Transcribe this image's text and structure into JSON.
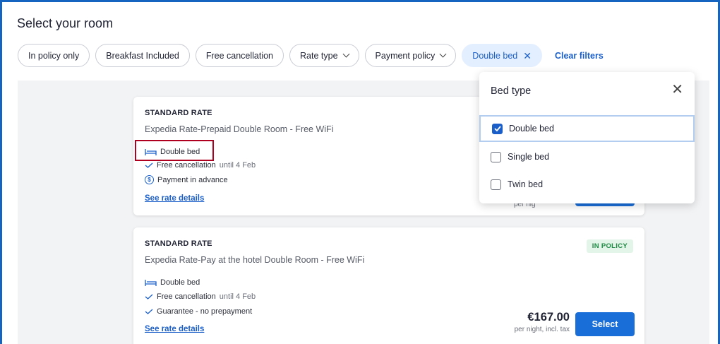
{
  "page": {
    "title": "Select your room"
  },
  "filters": {
    "chips": [
      {
        "label": "In policy only"
      },
      {
        "label": "Breakfast Included"
      },
      {
        "label": "Free cancellation"
      },
      {
        "label": "Rate type"
      },
      {
        "label": "Payment policy"
      },
      {
        "label": "Double bed"
      }
    ],
    "clear_label": "Clear filters"
  },
  "rates": [
    {
      "title": "STANDARD RATE",
      "description": "Expedia Rate-Prepaid Double Room - Free WiFi",
      "bed": "Double bed",
      "cancellation": "Free cancellation",
      "cancellation_until": "until 4 Feb",
      "payment": "Payment in advance",
      "details_link": "See rate details",
      "price_sub_peek": "per nig"
    },
    {
      "title": "STANDARD RATE",
      "description": "Expedia Rate-Pay at the hotel Double Room - Free WiFi",
      "badge": "IN POLICY",
      "bed": "Double bed",
      "cancellation": "Free cancellation",
      "cancellation_until": "until 4 Feb",
      "payment": "Guarantee - no prepayment",
      "details_link": "See rate details",
      "price": "€167.00",
      "price_sub": "per night, incl. tax",
      "select_label": "Select"
    }
  ],
  "bed_popover": {
    "title": "Bed type",
    "options": [
      {
        "label": "Double bed",
        "checked": true
      },
      {
        "label": "Single bed",
        "checked": false
      },
      {
        "label": "Twin bed",
        "checked": false
      }
    ]
  },
  "colors": {
    "accent": "#1a5fc9",
    "button": "#1a6ed8",
    "highlight": "#b00020",
    "policy_badge": "#1e8a45"
  },
  "icons": [
    "bed-icon",
    "check-icon",
    "dollar-circle-icon",
    "chevron-down-icon",
    "close-icon",
    "checkbox-icon"
  ]
}
